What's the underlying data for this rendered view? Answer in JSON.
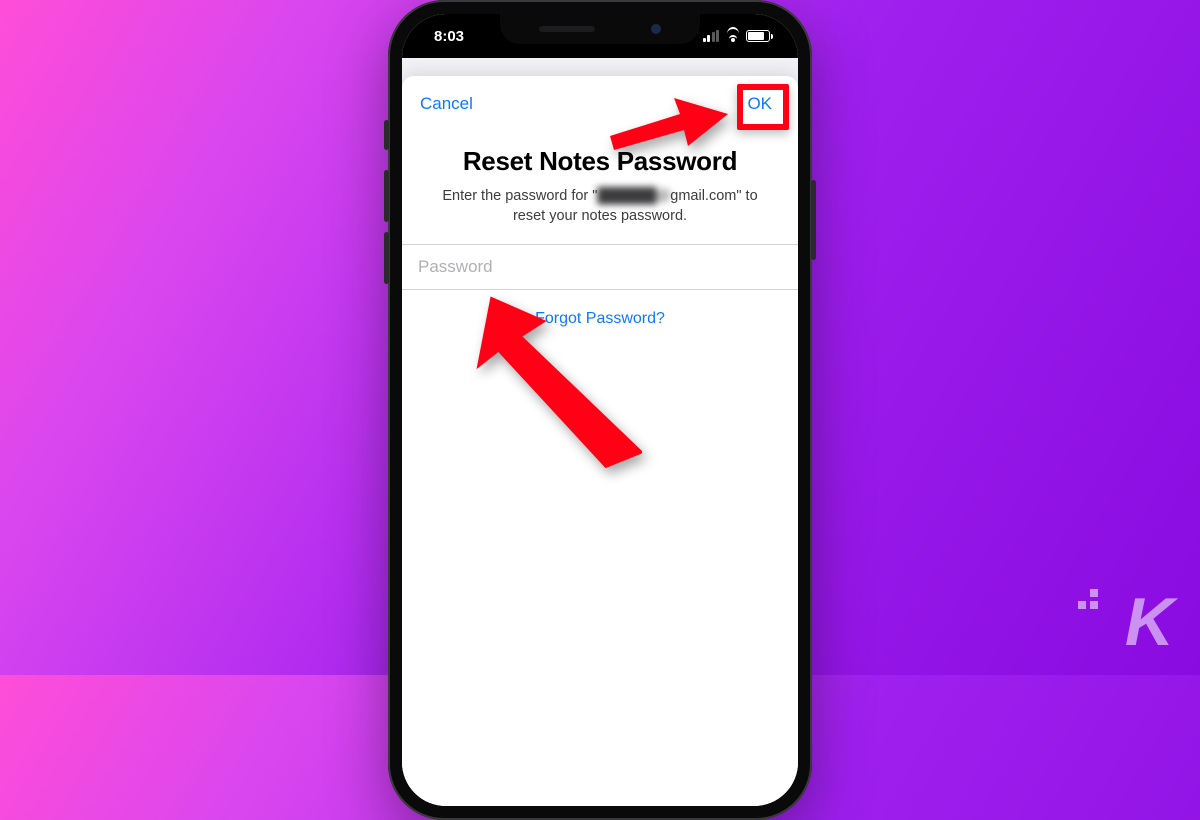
{
  "status": {
    "time": "8:03"
  },
  "modal": {
    "cancel_label": "Cancel",
    "ok_label": "OK",
    "title": "Reset Notes Password",
    "subtitle_prefix": "Enter the password for \"",
    "subtitle_email_blurred": "██████@",
    "subtitle_email_domain": "gmail.com",
    "subtitle_suffix": "\" to reset your notes password.",
    "password_placeholder": "Password",
    "forgot_label": "Forgot Password?"
  },
  "annotations": {
    "highlight_target": "OK button",
    "arrow1_points_to": "OK button",
    "arrow2_points_to": "Password field"
  },
  "watermark": {
    "letter": "K"
  },
  "colors": {
    "ios_link": "#0a7aff",
    "annotation_red": "#ff0015"
  }
}
